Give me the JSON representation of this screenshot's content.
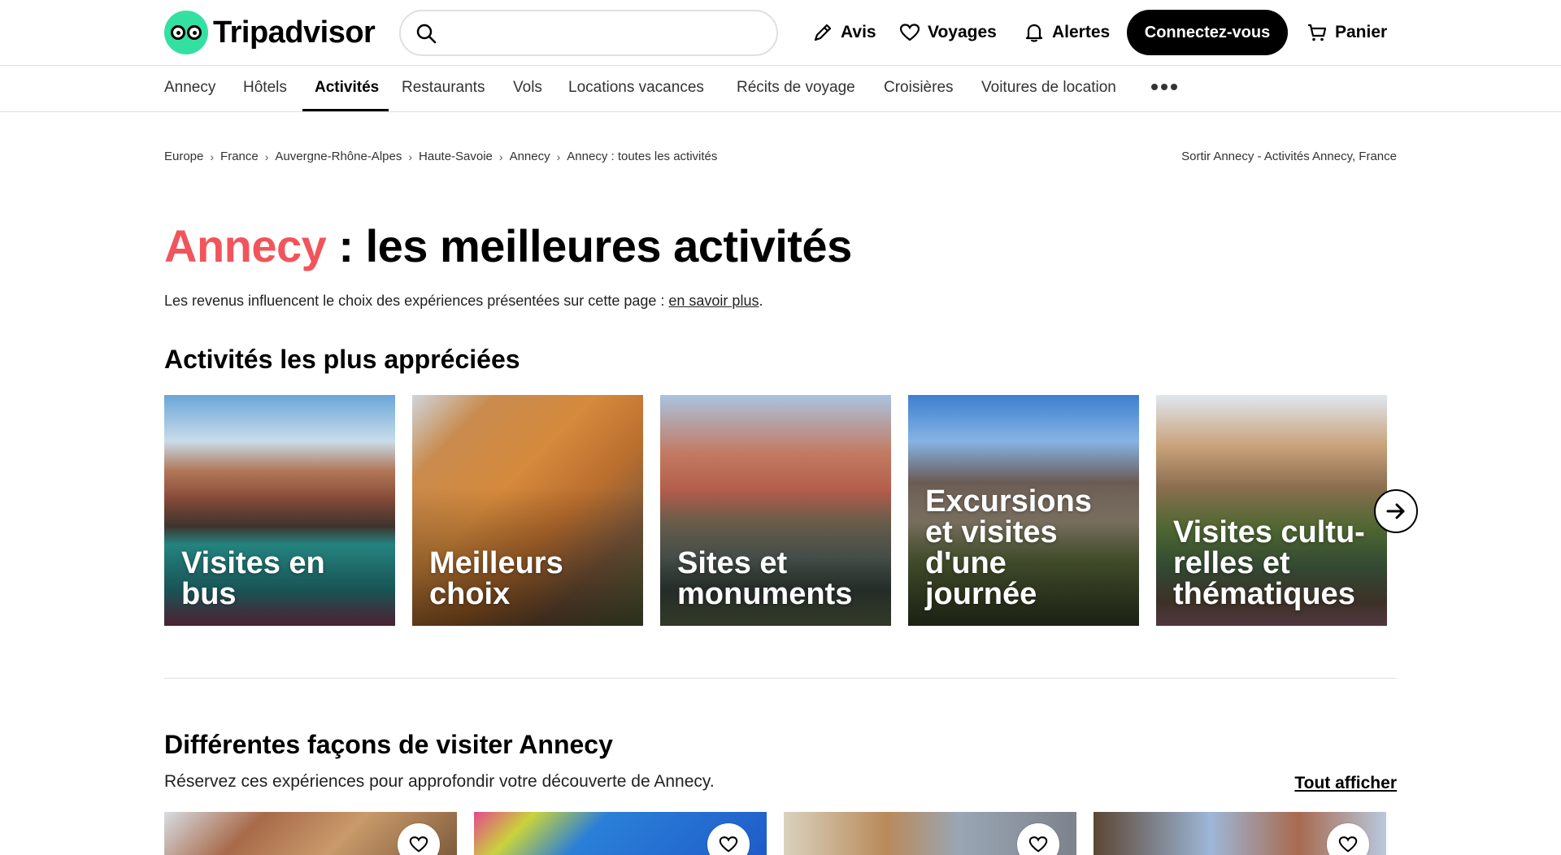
{
  "header": {
    "logo_text": "Tripadvisor",
    "search_placeholder": "",
    "nav": {
      "reviews": "Avis",
      "trips": "Voyages",
      "alerts": "Alertes",
      "login": "Connectez-vous",
      "cart": "Panier"
    }
  },
  "subnav": {
    "items": [
      "Annecy",
      "Hôtels",
      "Activités",
      "Restaurants",
      "Vols",
      "Locations vacances",
      "Récits de voyage",
      "Croisières",
      "Voitures de location"
    ],
    "active": "Activités"
  },
  "breadcrumb": {
    "items": [
      "Europe",
      "France",
      "Auvergne-Rhône-Alpes",
      "Haute-Savoie",
      "Annecy",
      "Annecy : toutes les activités"
    ],
    "right": "Sortir Annecy - Activités Annecy, France"
  },
  "title": {
    "city": "Annecy",
    "rest": " : les meilleures activités"
  },
  "subtitle": {
    "text": "Les revenus influencent le choix des expériences présentées sur cette page : ",
    "link": "en savoir plus",
    "end": "."
  },
  "popular": {
    "heading": "Activités les plus appréciées",
    "cards": [
      {
        "label": "Visites en bus"
      },
      {
        "label": "Meilleurs choix"
      },
      {
        "label": "Sites et monuments"
      },
      {
        "label": "Excursions et visites d'une journée"
      },
      {
        "label": "Visites cultu-relles et thématiques"
      }
    ]
  },
  "ways": {
    "heading": "Différentes façons de visiter Annecy",
    "description": "Réservez ces expériences pour approfondir votre découverte de Annecy.",
    "see_all": "Tout afficher"
  },
  "colors": {
    "brand_green": "#34e0a1",
    "accent_red": "#f2545b",
    "button_black": "#000000"
  },
  "icons": [
    "search-icon",
    "pencil-icon",
    "heart-icon",
    "bell-icon",
    "cart-icon",
    "more-icon",
    "arrow-right-icon"
  ]
}
